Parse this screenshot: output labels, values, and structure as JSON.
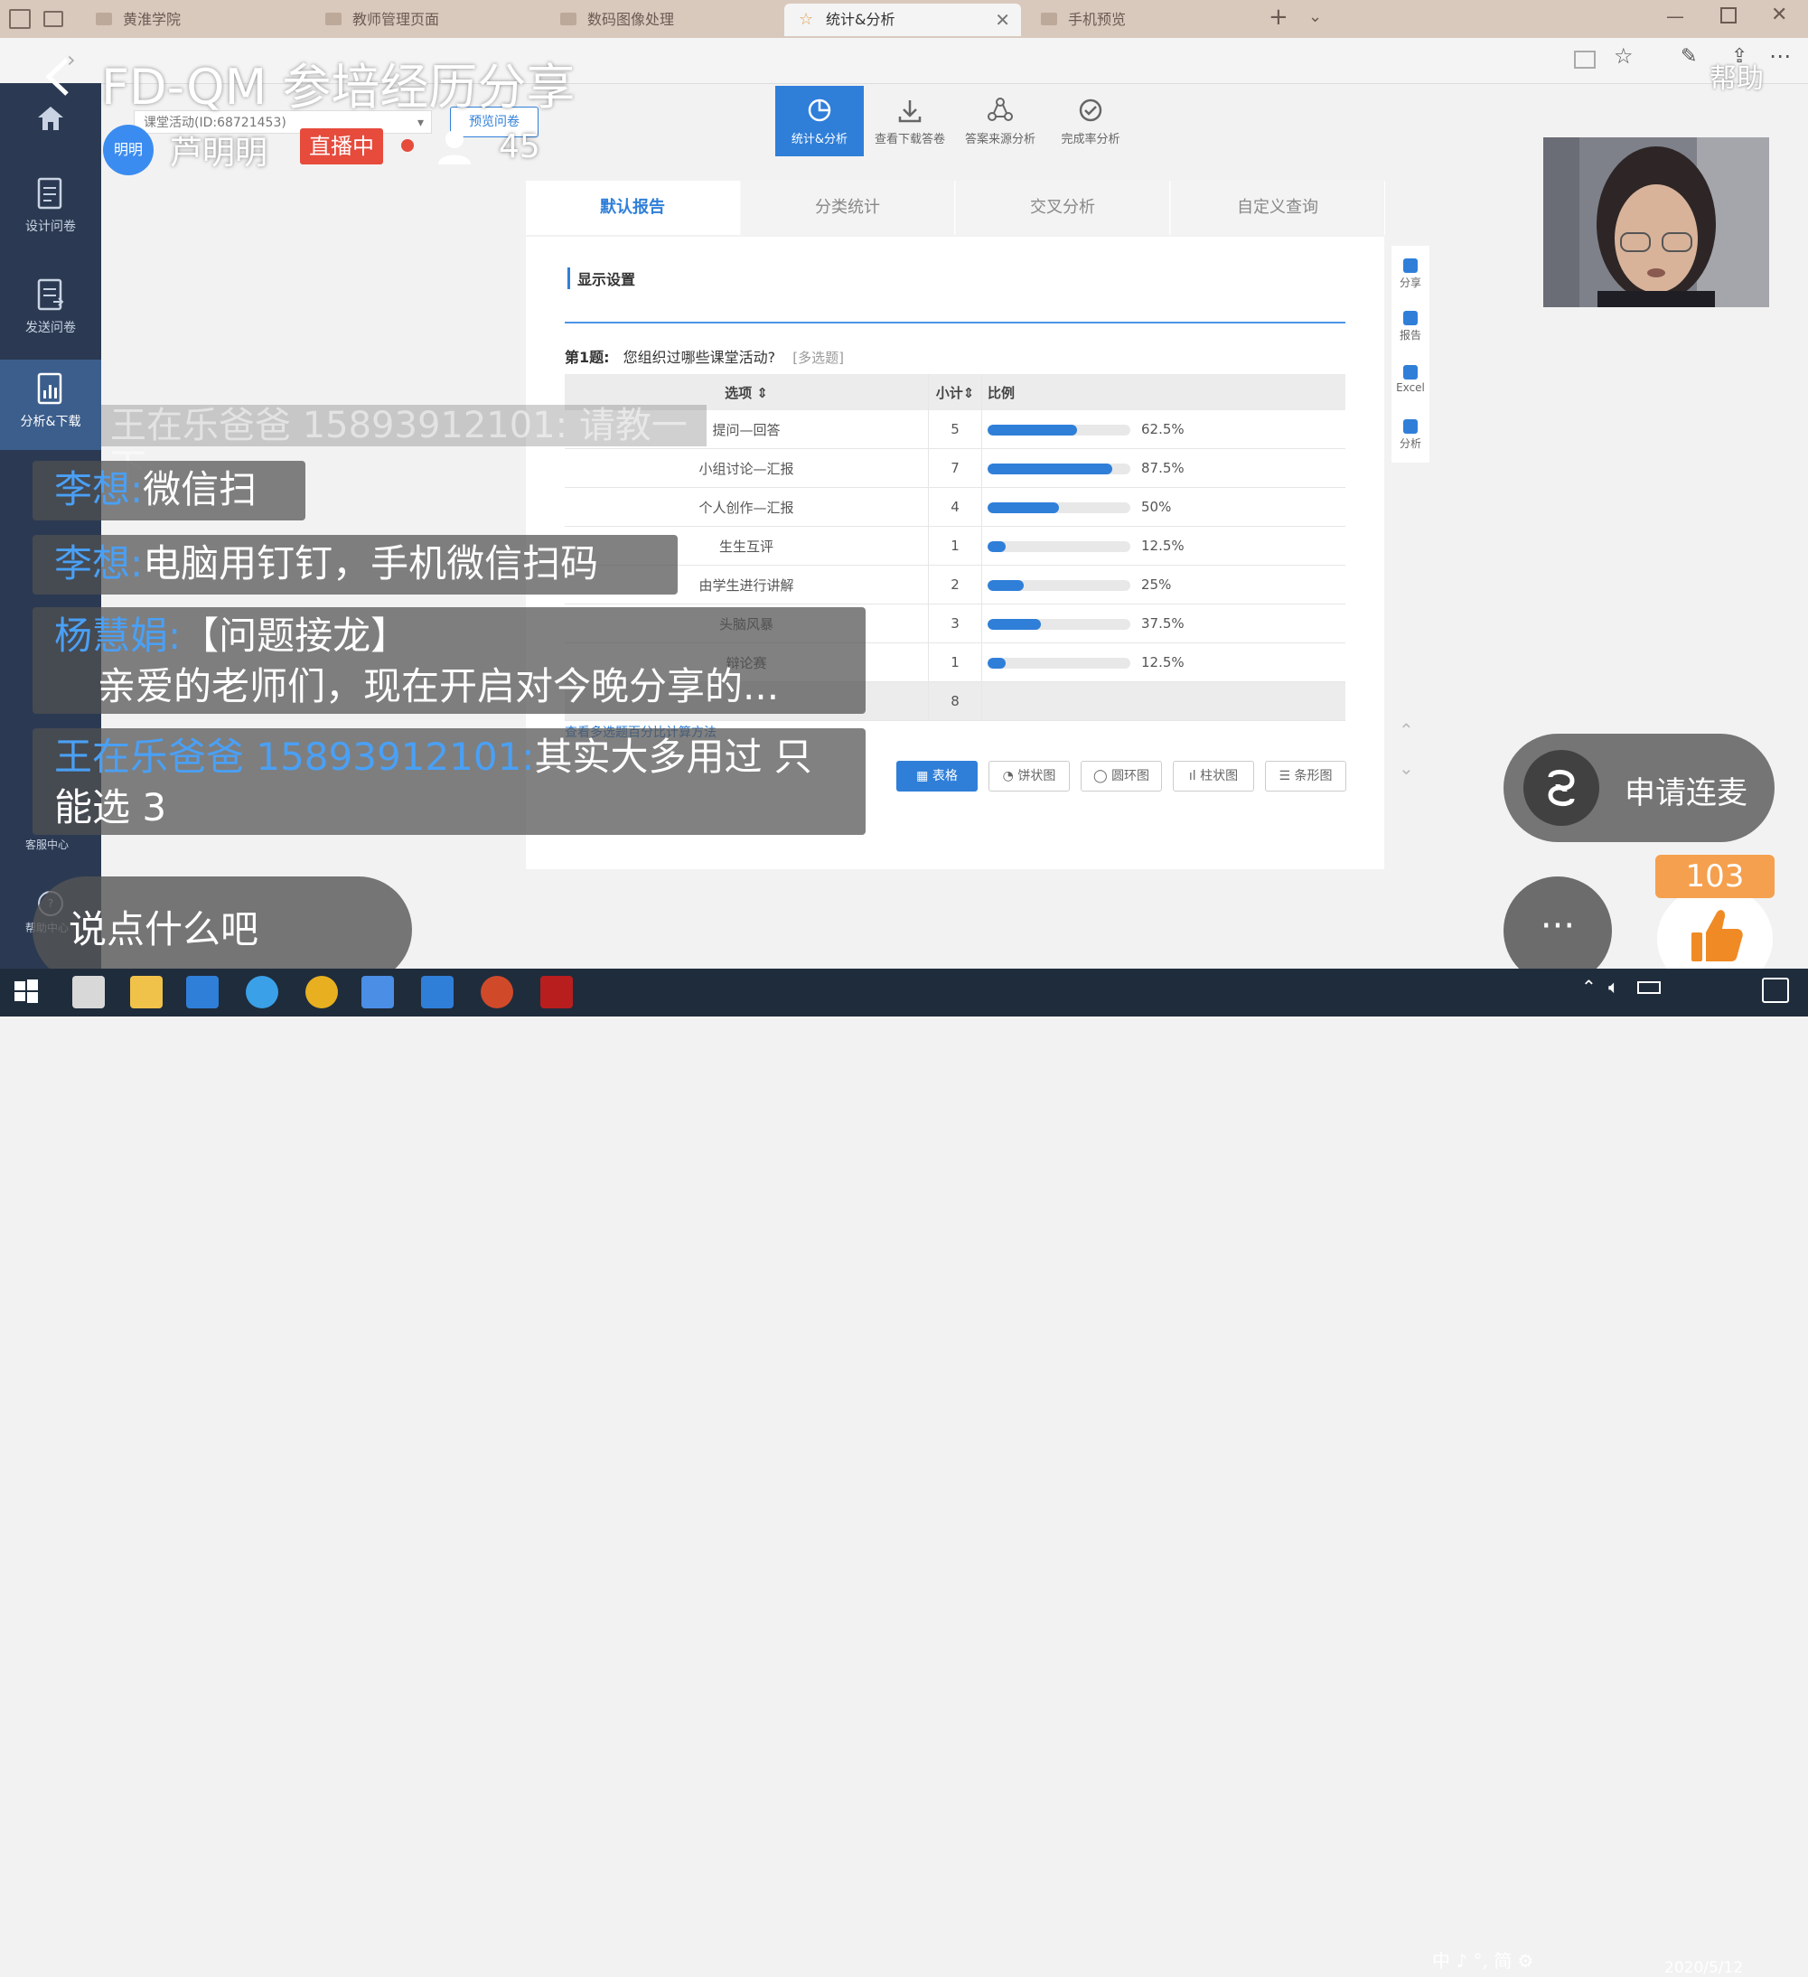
{
  "browser": {
    "tabs": [
      {
        "label": "黄淮学院",
        "active": false
      },
      {
        "label": "教师管理页面",
        "active": false
      },
      {
        "label": "数码图像处理",
        "active": false
      },
      {
        "label": "统计&分析",
        "active": true
      },
      {
        "label": "手机预览",
        "active": false
      }
    ],
    "new_tab": "+"
  },
  "survey": {
    "activity": "课堂活动(ID:68721453)",
    "preview": "预览问卷",
    "toolbar": [
      "统计&分析",
      "查看下载答卷",
      "答案来源分析",
      "完成率分析"
    ],
    "sidebar": [
      "设计问卷",
      "发送问卷",
      "分析&下载",
      "客服中心",
      "帮助中心"
    ],
    "report_tabs": [
      "默认报告",
      "分类统计",
      "交叉分析",
      "自定义查询"
    ],
    "settings_title": "显示设置",
    "question_no": "第1题:",
    "question_text": "您组织过哪些课堂活动?",
    "question_type": "[多选题]",
    "table_headers": {
      "option": "选项",
      "count": "小计",
      "ratio": "比例"
    },
    "rows": [
      {
        "option": "提问—回答",
        "count": "5",
        "ratio_text": "62.5%",
        "ratio": 62.5
      },
      {
        "option": "小组讨论—汇报",
        "count": "7",
        "ratio_text": "87.5%",
        "ratio": 87.5
      },
      {
        "option": "个人创作—汇报",
        "count": "4",
        "ratio_text": "50%",
        "ratio": 50
      },
      {
        "option": "生生互评",
        "count": "1",
        "ratio_text": "12.5%",
        "ratio": 12.5
      },
      {
        "option": "由学生进行讲解",
        "count": "2",
        "ratio_text": "25%",
        "ratio": 25
      },
      {
        "option": "头脑风暴",
        "count": "3",
        "ratio_text": "37.5%",
        "ratio": 37.5
      },
      {
        "option": "辩论赛",
        "count": "1",
        "ratio_text": "12.5%",
        "ratio": 12.5
      }
    ],
    "total": "8",
    "calc_link": "查看多选题百分比计算方法",
    "chart_buttons": [
      "表格",
      "饼状图",
      "圆环图",
      "柱状图",
      "条形图"
    ],
    "right_tools": [
      "分享",
      "报告",
      "Excel",
      "分析"
    ],
    "accent": "#2f7fd9"
  },
  "live": {
    "title": "FD-QM 参培经历分享",
    "help": "帮助",
    "host_avatar": "明明",
    "host_name": "芦明明",
    "status": "直播中",
    "viewers": "45",
    "chat": [
      {
        "name": "王在乐爸爸 15893912101:",
        "text": "请教一下"
      },
      {
        "name": "李想:",
        "text": "微信扫"
      },
      {
        "name": "李想:",
        "text": "电脑用钉钉，手机微信扫码"
      },
      {
        "name": "杨慧娟:",
        "text": "【问题接龙】",
        "text2": "亲爱的老师们，现在开启对今晚分享的..."
      },
      {
        "name": "王在乐爸爸 15893912101:",
        "text": "其实大多用过 只",
        "text2": "能选 3"
      }
    ],
    "input_placeholder": "说点什么吧",
    "mic": "申请连麦",
    "more": "···",
    "likes": "103"
  },
  "taskbar": {
    "tray": "中 ♪ °, 简 ⚙",
    "date": "2020/5/12"
  }
}
